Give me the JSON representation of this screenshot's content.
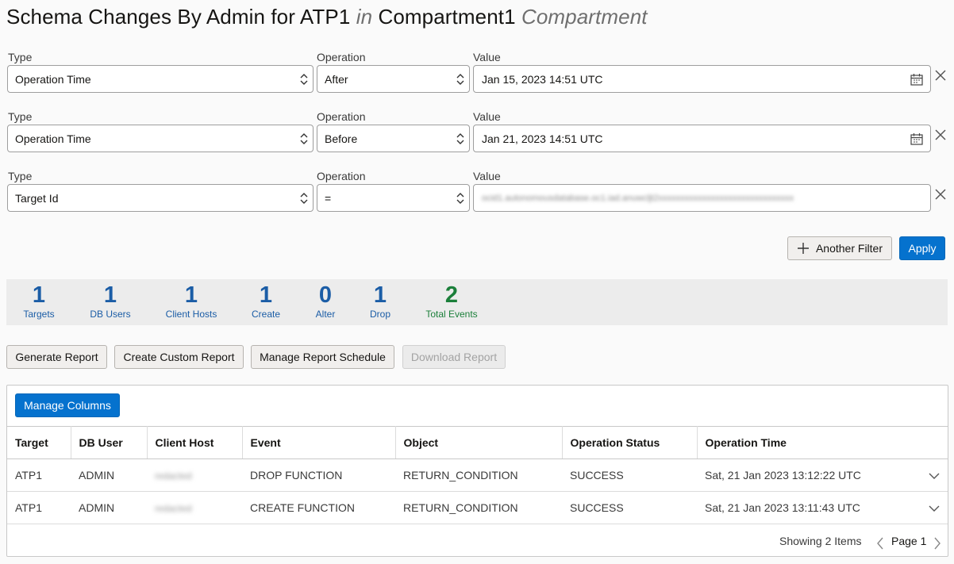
{
  "header": {
    "title_part1": "Schema Changes By Admin for ATP1",
    "title_in": "in",
    "title_part2": "Compartment1",
    "title_suffix": "Compartment"
  },
  "filter_labels": {
    "type": "Type",
    "operation": "Operation",
    "value": "Value"
  },
  "filters": [
    {
      "type": "Operation Time",
      "operation": "After",
      "value": "Jan 15, 2023 14:51 UTC"
    },
    {
      "type": "Operation Time",
      "operation": "Before",
      "value": "Jan 21, 2023 14:51 UTC"
    },
    {
      "type": "Target Id",
      "operation": "=",
      "value": "ocid1.autonomousdatabase.oc1.iad.anuwcljt2xxxxxxxxxxxxxxxxxxxxxxxxxxxxxxx"
    }
  ],
  "actions": {
    "another_filter": "Another Filter",
    "apply": "Apply"
  },
  "stats": [
    {
      "value": "1",
      "label": "Targets"
    },
    {
      "value": "1",
      "label": "DB Users"
    },
    {
      "value": "1",
      "label": "Client Hosts"
    },
    {
      "value": "1",
      "label": "Create"
    },
    {
      "value": "0",
      "label": "Alter"
    },
    {
      "value": "1",
      "label": "Drop"
    },
    {
      "value": "2",
      "label": "Total Events"
    }
  ],
  "colors": {
    "stat_blue": "#1b5da6",
    "stat_green": "#1b7f3a",
    "primary": "#0572ce"
  },
  "report_buttons": {
    "generate": "Generate Report",
    "custom": "Create Custom Report",
    "schedule": "Manage Report Schedule",
    "download": "Download Report"
  },
  "table": {
    "manage_columns": "Manage Columns",
    "columns": [
      "Target",
      "DB User",
      "Client Host",
      "Event",
      "Object",
      "Operation Status",
      "Operation Time"
    ],
    "rows": [
      [
        "ATP1",
        "ADMIN",
        "redacted",
        "DROP FUNCTION",
        "RETURN_CONDITION",
        "SUCCESS",
        "Sat, 21 Jan 2023 13:12:22 UTC"
      ],
      [
        "ATP1",
        "ADMIN",
        "redacted",
        "CREATE FUNCTION",
        "RETURN_CONDITION",
        "SUCCESS",
        "Sat, 21 Jan 2023 13:11:43 UTC"
      ]
    ],
    "footer": {
      "showing": "Showing 2 Items",
      "page": "Page 1"
    }
  }
}
